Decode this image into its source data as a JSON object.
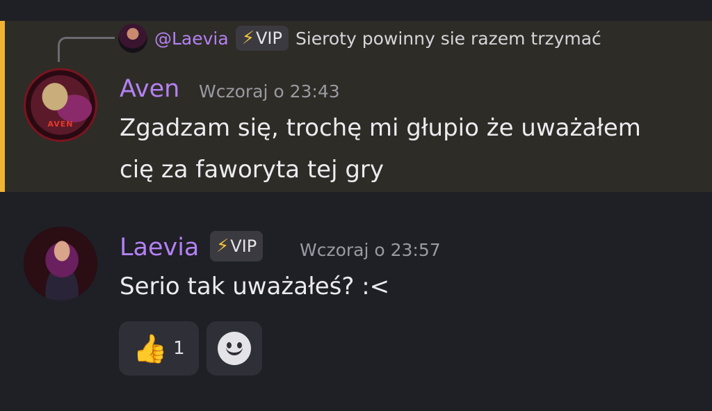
{
  "reply": {
    "author": "@Laevia",
    "vip_label": "VIP",
    "text": "Sieroty powinny sie razem trzymać"
  },
  "messages": [
    {
      "author": "Aven",
      "timestamp": "Wczoraj o 23:43",
      "lines": [
        "Zgadzam się, trochę mi głupio że uważałem",
        "cię za faworyta tej gry"
      ],
      "avatar_label": "AVEN"
    },
    {
      "author": "Laevia",
      "vip_label": "VIP",
      "timestamp": "Wczoraj o 23:57",
      "text": "Serio tak uważałeś? :<",
      "reactions": [
        {
          "emoji": "thumbs-up",
          "count": "1"
        }
      ]
    }
  ],
  "colors": {
    "background": "#1f1f26",
    "highlight": "#2e2c27",
    "mention_bar": "#f0b232",
    "username": "#b481f3"
  }
}
